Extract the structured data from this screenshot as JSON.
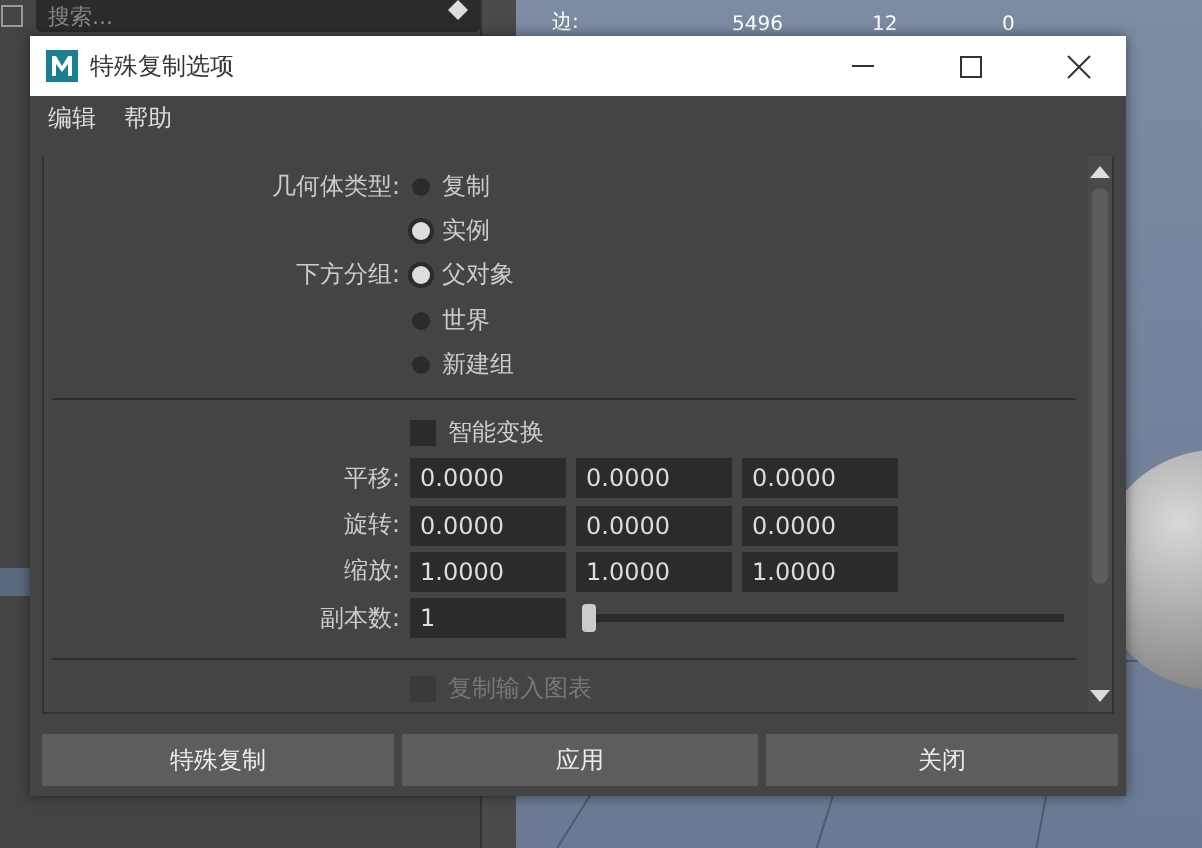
{
  "outliner": {
    "search": {
      "placeholder": "搜索..."
    }
  },
  "viewport": {
    "stats": [
      {
        "label": "边:",
        "values": [
          "5496",
          "12",
          "0"
        ]
      }
    ]
  },
  "window": {
    "title": "特殊复制选项"
  },
  "menu": [
    "编辑",
    "帮助"
  ],
  "option_groups": [
    {
      "label": "几何体类型:",
      "options": [
        {
          "label": "复制",
          "selected": false
        },
        {
          "label": "实例",
          "selected": true
        }
      ]
    },
    {
      "label": "下方分组:",
      "options": [
        {
          "label": "父对象",
          "selected": true
        },
        {
          "label": "世界",
          "selected": false
        },
        {
          "label": "新建组",
          "selected": false
        }
      ]
    }
  ],
  "smart_transform": {
    "label": "智能变换",
    "checked": false,
    "disabled": false
  },
  "transforms": [
    {
      "label": "平移:",
      "values": [
        "0.0000",
        "0.0000",
        "0.0000"
      ]
    },
    {
      "label": "旋转:",
      "values": [
        "0.0000",
        "0.0000",
        "0.0000"
      ]
    },
    {
      "label": "缩放:",
      "values": [
        "1.0000",
        "1.0000",
        "1.0000"
      ]
    }
  ],
  "copies": {
    "label": "副本数:",
    "value": "1",
    "level": 0
  },
  "duplicate_input_graph": {
    "label": "复制输入图表",
    "checked": false,
    "disabled": true
  },
  "buttons": [
    "特殊复制",
    "应用",
    "关闭"
  ]
}
